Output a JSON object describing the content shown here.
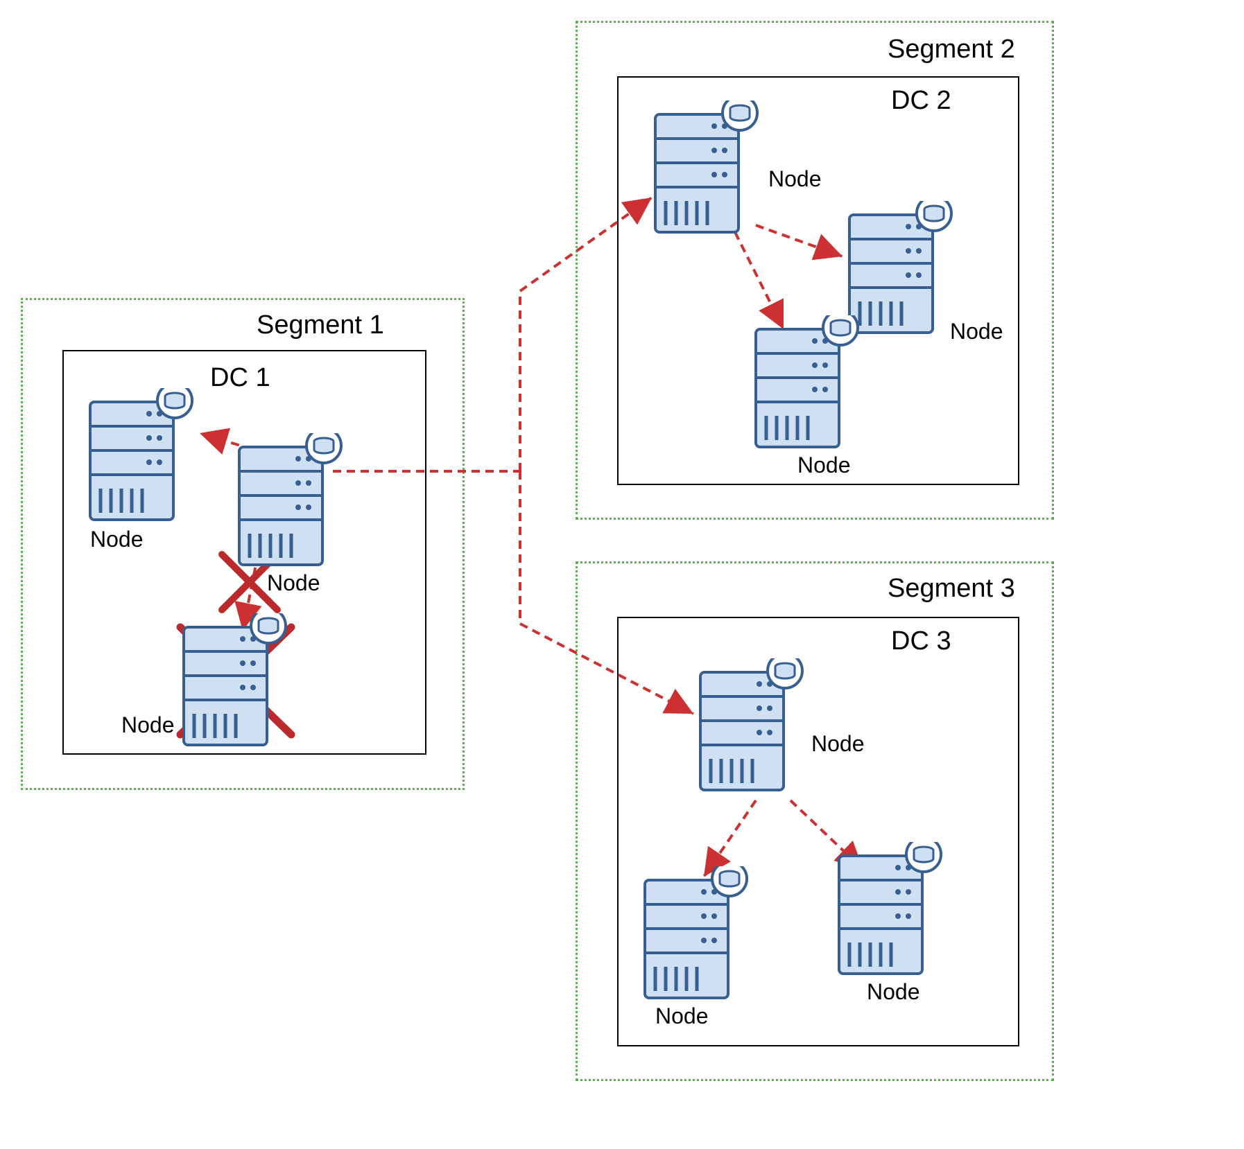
{
  "segments": {
    "s1": {
      "label": "Segment 1"
    },
    "s2": {
      "label": "Segment 2"
    },
    "s3": {
      "label": "Segment 3"
    }
  },
  "datacenters": {
    "dc1": {
      "label": "DC 1"
    },
    "dc2": {
      "label": "DC 2"
    },
    "dc3": {
      "label": "DC 3"
    }
  },
  "nodes": {
    "dc1a": {
      "label": "Node"
    },
    "dc1b": {
      "label": "Node"
    },
    "dc1c": {
      "label": "Node"
    },
    "dc2a": {
      "label": "Node"
    },
    "dc2b": {
      "label": "Node"
    },
    "dc2c": {
      "label": "Node"
    },
    "dc3a": {
      "label": "Node"
    },
    "dc3b": {
      "label": "Node"
    },
    "dc3c": {
      "label": "Node"
    }
  },
  "colors": {
    "segmentBorder": "#59b24e",
    "serverFill": "#cfe0f3",
    "serverStroke": "#375f91",
    "arrow": "#cc3030",
    "xmark": "#bb2b2b"
  }
}
